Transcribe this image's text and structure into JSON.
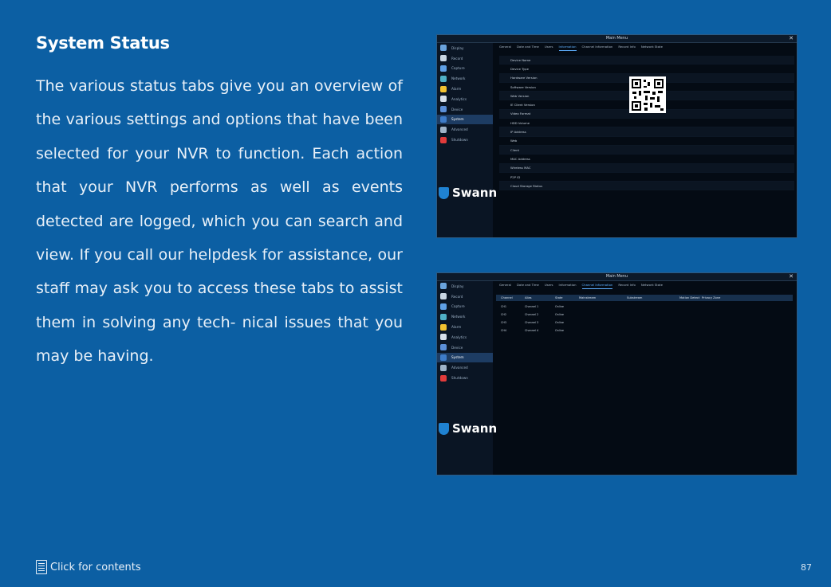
{
  "title": "System Status",
  "paragraph_lines": [
    "The various status tabs give you an overview",
    "of the various settings and options that have",
    "been selected for your NVR to function. Each",
    "action that your NVR performs as well as",
    "events detected are logged, which you can",
    "search and view. If you call our helpdesk for",
    "assistance, our staff may ask you to access",
    "these tabs to assist them in solving any tech-",
    "nical issues that you may be having."
  ],
  "screen": {
    "window_title": "Main Menu",
    "close": "✕",
    "brand": "Swann",
    "sidebar": [
      "Display",
      "Record",
      "Capture",
      "Network",
      "Alarm",
      "Analytics",
      "Device",
      "System",
      "Advanced",
      "Shutdown"
    ],
    "active_sidebar_index": 7,
    "tabs": [
      "General",
      "Date and Time",
      "Users",
      "Information",
      "Channel Information",
      "Record Info",
      "Network State"
    ]
  },
  "screen1_rows": [
    "Device Name",
    "Device Type",
    "Hardware Version",
    "Software Version",
    "Web Version",
    "IE Client Version",
    "Video Format",
    "HDD Volume",
    "IP Address",
    "Web",
    "Client",
    "MAC Address",
    "Wireless MAC",
    "P2P ID",
    "Cloud Storage Status"
  ],
  "screen2_headers": [
    "Channel",
    "Alias",
    "State",
    "Mainstream",
    "Substream",
    "Motion Detect",
    "Privacy Zone"
  ],
  "screen2_rows": [
    [
      "CH1",
      "Channel 1",
      "Online"
    ],
    [
      "CH2",
      "Channel 2",
      "Online"
    ],
    [
      "CH3",
      "Channel 3",
      "Online"
    ],
    [
      "CH4",
      "Channel 4",
      "Online"
    ]
  ],
  "footer": {
    "link": "Click for contents",
    "page": "87"
  },
  "colors": {
    "background": "#0c5fa3",
    "accent": "#5fb0ff"
  }
}
